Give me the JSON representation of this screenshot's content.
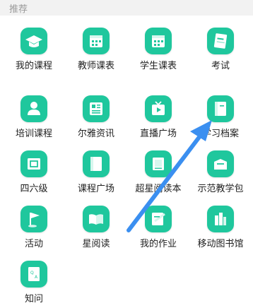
{
  "section": {
    "title": "推荐"
  },
  "tiles": [
    {
      "label": "我的课程",
      "icon": "graduation-cap-icon"
    },
    {
      "label": "教师课表",
      "icon": "calendar-icon"
    },
    {
      "label": "学生课表",
      "icon": "calendar-icon"
    },
    {
      "label": "考试",
      "icon": "exam-paper-icon"
    },
    {
      "label": "培训课程",
      "icon": "trainer-icon"
    },
    {
      "label": "尔雅资讯",
      "icon": "news-icon"
    },
    {
      "label": "直播广场",
      "icon": "live-tv-icon"
    },
    {
      "label": "学习档案",
      "icon": "archive-book-icon"
    },
    {
      "label": "四六级",
      "icon": "cet-certificate-icon"
    },
    {
      "label": "课程广场",
      "icon": "course-book-icon"
    },
    {
      "label": "超星阅读本",
      "icon": "reader-icon"
    },
    {
      "label": "示范教学包",
      "icon": "teaching-package-icon"
    },
    {
      "label": "活动",
      "icon": "flag-icon"
    },
    {
      "label": "星阅读",
      "icon": "open-book-icon"
    },
    {
      "label": "我的作业",
      "icon": "homework-icon"
    },
    {
      "label": "移动图书馆",
      "icon": "library-icon"
    },
    {
      "label": "知问",
      "icon": "qa-icon"
    }
  ],
  "colors": {
    "icon_bg": "#1fc79d",
    "arrow": "#3b8ff0",
    "header_bg": "#f2f2f2"
  }
}
